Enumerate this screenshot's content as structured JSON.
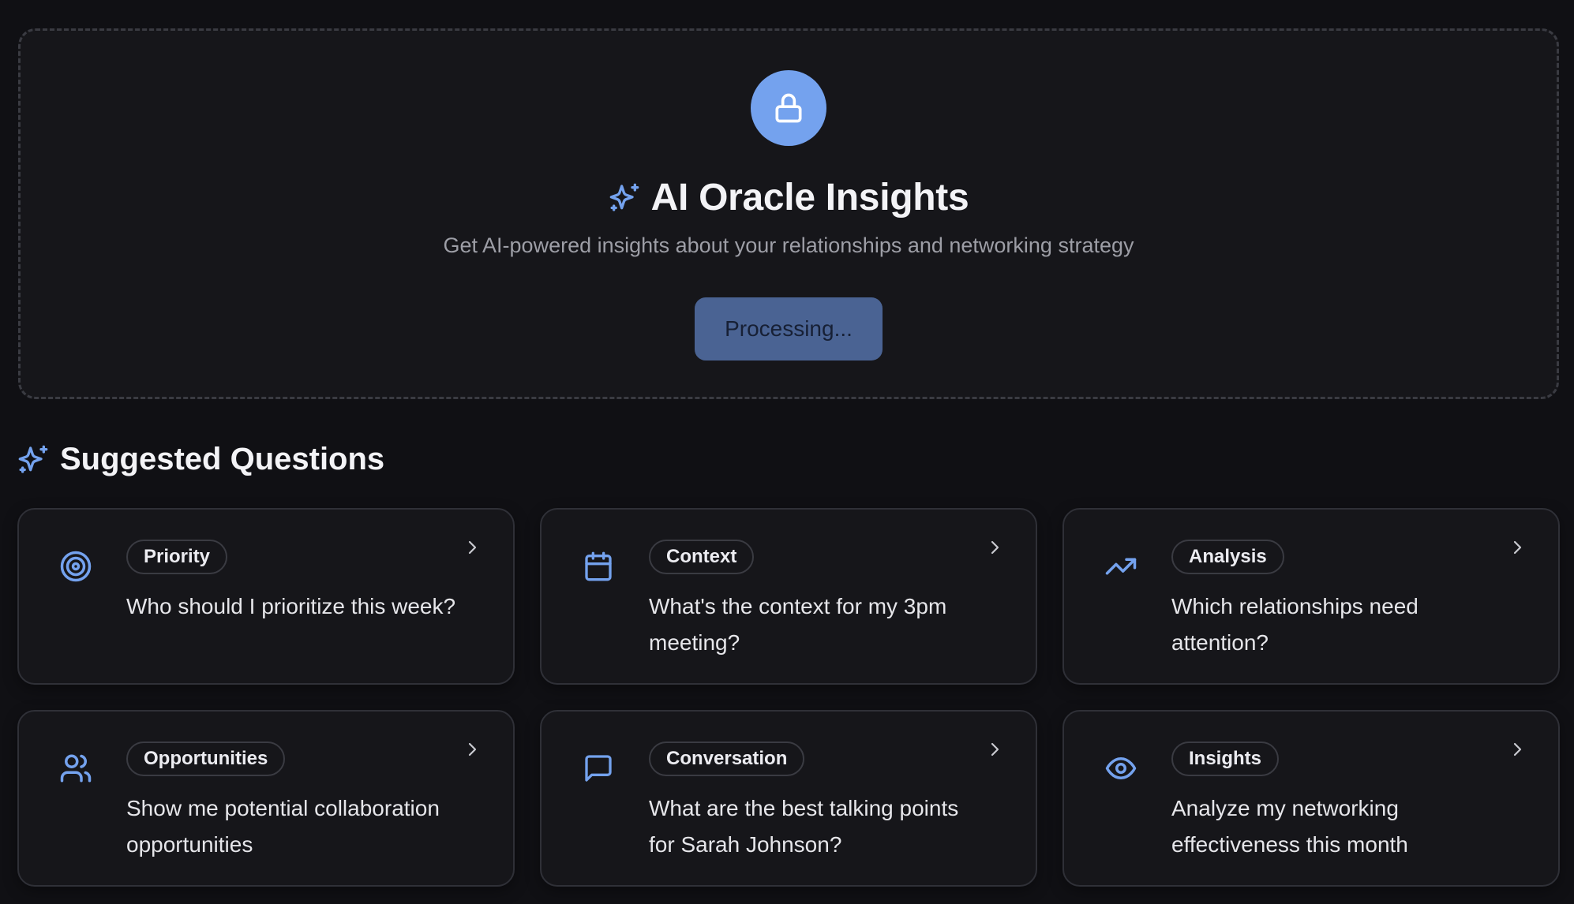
{
  "hero": {
    "title": "AI Oracle Insights",
    "subtitle": "Get AI-powered insights about your relationships and networking strategy",
    "button_label": "Processing...",
    "lock_icon": "lock-icon",
    "sparkle_icon": "sparkles-icon"
  },
  "suggested": {
    "title": "Suggested Questions",
    "icon": "sparkles-icon",
    "cards": [
      {
        "tag": "Priority",
        "question": "Who should I prioritize this week?",
        "icon": "target-icon"
      },
      {
        "tag": "Context",
        "question": "What's the context for my 3pm meeting?",
        "icon": "calendar-icon"
      },
      {
        "tag": "Analysis",
        "question": "Which relationships need attention?",
        "icon": "trending-up-icon"
      },
      {
        "tag": "Opportunities",
        "question": "Show me potential collaboration opportunities",
        "icon": "users-icon"
      },
      {
        "tag": "Conversation",
        "question": "What are the best talking points for Sarah Johnson?",
        "icon": "message-square-icon"
      },
      {
        "tag": "Insights",
        "question": "Analyze my networking effectiveness this month",
        "icon": "eye-icon"
      }
    ]
  },
  "colors": {
    "accent": "#74a2ee",
    "background": "#101014",
    "card": "#16161a",
    "border": "#2f3037",
    "button": "#4a6393"
  }
}
